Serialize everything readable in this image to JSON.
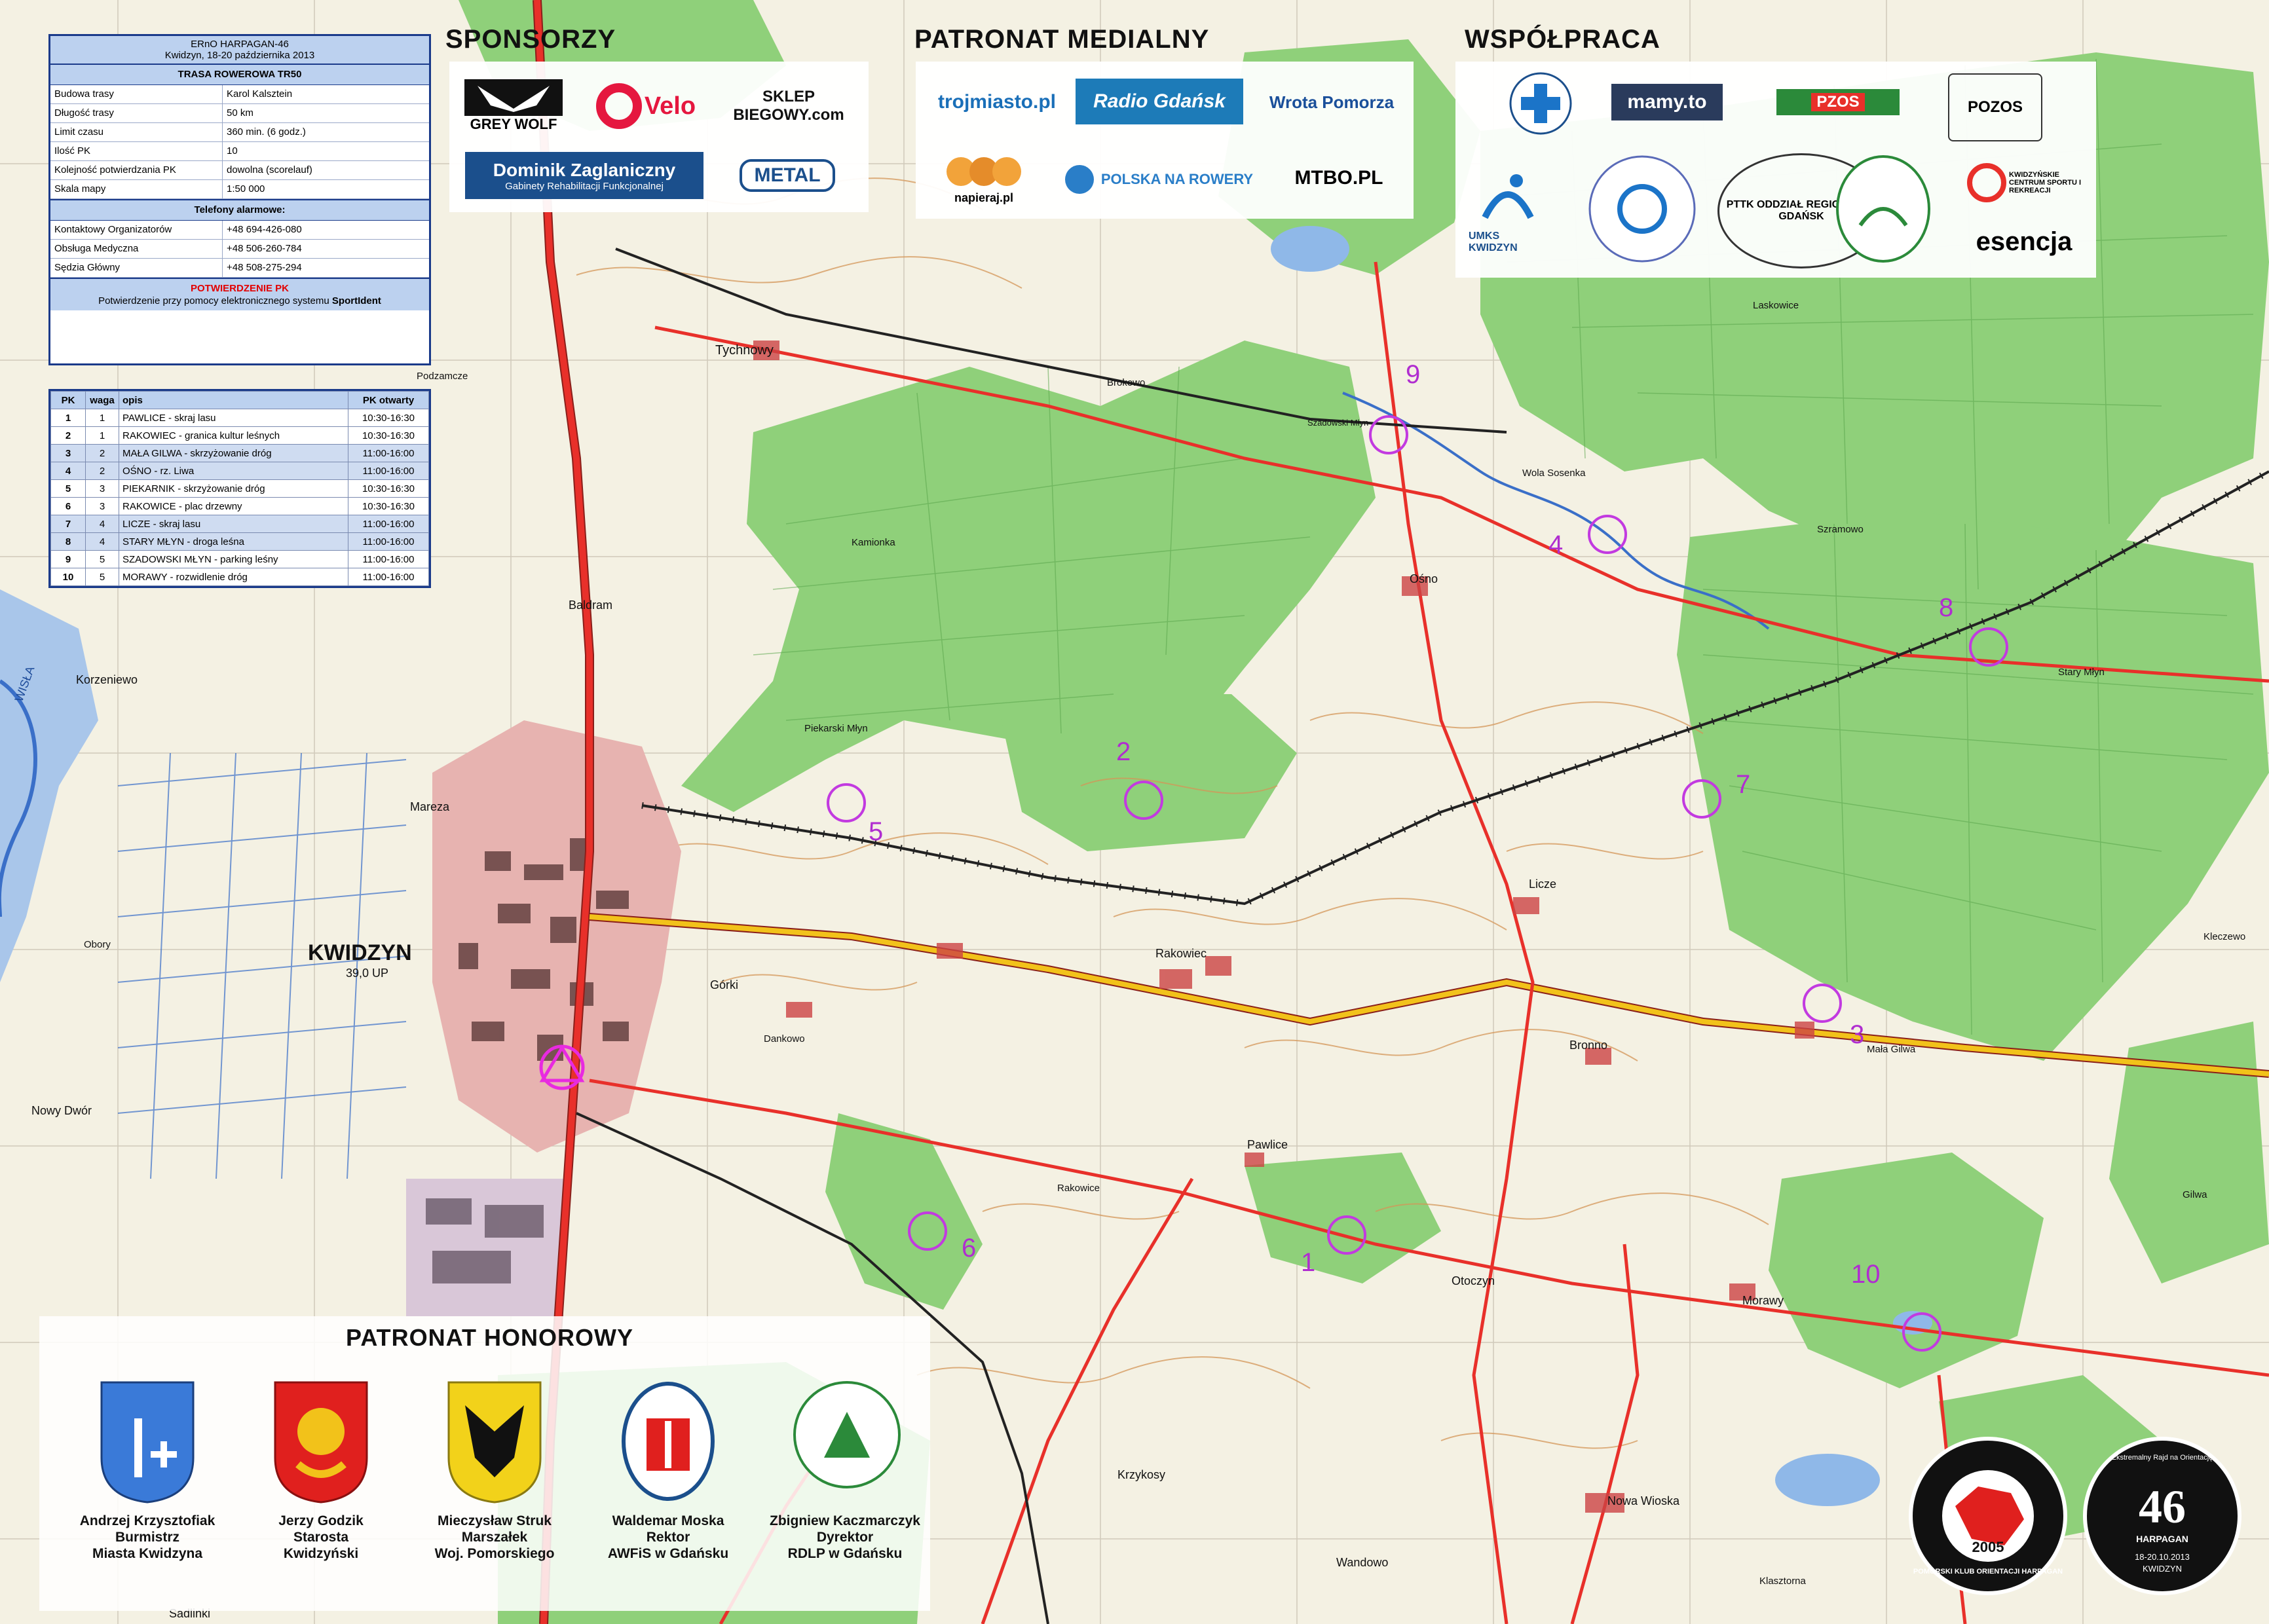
{
  "colors": {
    "forest": "#8fd07a",
    "paper": "#f4f1e3",
    "contour": "#d49558",
    "road": "#e8302a",
    "water": "#3a6fc8",
    "checkpoint": "#c23ae0",
    "panel_border": "#1a3a8a"
  },
  "info": {
    "event": "ERnO HARPAGAN-46",
    "place_date": "Kwidzyn, 18-20 października 2013",
    "route_title": "TRASA ROWEROWA TR50",
    "rows": [
      {
        "label": "Budowa trasy",
        "value": "Karol Kalsztein"
      },
      {
        "label": "Długość trasy",
        "value": "50 km"
      },
      {
        "label": "Limit czasu",
        "value": "360 min. (6 godz.)"
      },
      {
        "label": "Ilość PK",
        "value": "10"
      },
      {
        "label": "Kolejność potwierdzania PK",
        "value": "dowolna (scorelauf)"
      },
      {
        "label": "Skala mapy",
        "value": "1:50 000"
      }
    ],
    "phones_title": "Telefony alarmowe:",
    "phones": [
      {
        "label": "Kontaktowy Organizatorów",
        "value": "+48 694-426-080"
      },
      {
        "label": "Obsługa Medyczna",
        "value": "+48 506-260-784"
      },
      {
        "label": "Sędzia Główny",
        "value": "+48 508-275-294"
      }
    ],
    "confirm_title": "POTWIERDZENIE PK",
    "confirm_text_a": "Potwierdzenie przy pomocy elektronicznego systemu",
    "confirm_text_b": "SportIdent"
  },
  "pk_table": {
    "headers": [
      "PK",
      "waga",
      "opis",
      "PK otwarty"
    ],
    "rows": [
      [
        "1",
        "1",
        "PAWLICE - skraj lasu",
        "10:30-16:30"
      ],
      [
        "2",
        "1",
        "RAKOWIEC - granica kultur leśnych",
        "10:30-16:30"
      ],
      [
        "3",
        "2",
        "MAŁA GILWA - skrzyżowanie dróg",
        "11:00-16:00"
      ],
      [
        "4",
        "2",
        "OŚNO - rz. Liwa",
        "11:00-16:00"
      ],
      [
        "5",
        "3",
        "PIEKARNIK - skrzyżowanie dróg",
        "10:30-16:30"
      ],
      [
        "6",
        "3",
        "RAKOWICE - plac drzewny",
        "10:30-16:30"
      ],
      [
        "7",
        "4",
        "LICZE - skraj lasu",
        "11:00-16:00"
      ],
      [
        "8",
        "4",
        "STARY MŁYN - droga leśna",
        "11:00-16:00"
      ],
      [
        "9",
        "5",
        "SZADOWSKI MŁYN - parking leśny",
        "11:00-16:00"
      ],
      [
        "10",
        "5",
        "MORAWY - rozwidlenie dróg",
        "11:00-16:00"
      ]
    ]
  },
  "sections": {
    "sponsors": "SPONSORZY",
    "media": "PATRONAT MEDIALNY",
    "cooperation": "WSPÓŁPRACA",
    "honorary": "PATRONAT HONOROWY"
  },
  "sponsor_logos": [
    "GREY WOLF",
    "Velo",
    "SKLEP BIEGOWY.com",
    "Dominik Zaglaniczny",
    "Gabinety Rehabilitacji Funkcjonalnej",
    "METAL"
  ],
  "media_logos": [
    "trojmiasto.pl",
    "Radio Gdańsk",
    "Wrota Pomorza",
    "napieraj.pl",
    "POLSKA NA ROWERY",
    "MTBO.PL"
  ],
  "coop_logos": [
    "mamy.to",
    "PZOS",
    "POZOS",
    "UMKS KWIDZYN",
    "PTTK ODDZIAŁ REGIONALNY GDAŃSK",
    "KWIDZYŃSKIE CENTRUM SPORTU I REKREACJI",
    "esencja"
  ],
  "patrons": [
    {
      "line1": "Andrzej Krzysztofiak",
      "line2": "Burmistrz",
      "line3": "Miasta Kwidzyna",
      "crest": "kwidzyn-city-crest"
    },
    {
      "line1": "Jerzy Godzik",
      "line2": "Starosta",
      "line3": "Kwidzyński",
      "crest": "kwidzyn-county-crest"
    },
    {
      "line1": "Mieczysław Struk",
      "line2": "Marszałek",
      "line3": "Woj. Pomorskiego",
      "crest": "pomorskie-crest"
    },
    {
      "line1": "Waldemar Moska",
      "line2": "Rektor",
      "line3": "AWFiS w Gdańsku",
      "crest": "awfis-crest"
    },
    {
      "line1": "Zbigniew Kaczmarczyk",
      "line2": "Dyrektor",
      "line3": "RDLP w Gdańsku",
      "crest": "lasy-panstwowe-logo"
    }
  ],
  "badges": {
    "club": "POMORSKI KLUB ORIENTACJI HARPAGAN",
    "club_year": "2005",
    "event_badge": "HARPAGAN",
    "event_number": "46",
    "event_dates": "18-20.10.2013",
    "event_city": "KWIDZYN",
    "event_prefix": "Ekstremalny Rajd na Orientację"
  },
  "checkpoints": [
    {
      "n": "1",
      "label": "1"
    },
    {
      "n": "2",
      "label": "2"
    },
    {
      "n": "3",
      "label": "3"
    },
    {
      "n": "4",
      "label": "4"
    },
    {
      "n": "5",
      "label": "5"
    },
    {
      "n": "6",
      "label": "6"
    },
    {
      "n": "7",
      "label": "7"
    },
    {
      "n": "8",
      "label": "8"
    },
    {
      "n": "9",
      "label": "9"
    },
    {
      "n": "10",
      "label": "10"
    }
  ],
  "places": {
    "kwidzyn": "KWIDZYN",
    "kwidzyn_pop": "39,0 UP",
    "tychnowy": "Tychnowy",
    "brokowo": "Brokowo",
    "osno": "Ośno",
    "licze": "Licze",
    "rakowiec": "Rakowiec",
    "gorki": "Górki",
    "pawlice": "Pawlice",
    "otoczyn": "Otoczyn",
    "bronno": "Bronno",
    "mala_gilwa": "Mała Gilwa",
    "szramowo": "Szramowo",
    "morawy": "Morawy",
    "nowa_wioska": "Nowa Wioska",
    "krzykosy": "Krzykosy",
    "wandowo": "Wandowo",
    "korzeniewo": "Korzeniewo",
    "mareza": "Mareza",
    "nowy_dwor": "Nowy Dwór",
    "baldram": "Baldram",
    "kamionka": "Kamionka",
    "gilwa": "Gilwa",
    "kleczewo": "Kleczewo",
    "laskowice": "Laskowice",
    "rakowice": "Rakowice",
    "dankowo": "Dankowo",
    "sadlinki": "Sadlinki",
    "klasztorna": "Klasztorna",
    "szadowski_mlyn": "Szadowski Młyn",
    "wola_sosenka": "Wola Sosenka",
    "obory": "Obory",
    "podzamcze": "Podzamcze",
    "wisla": "WISŁA",
    "stary_mlyn": "Stary Młyn",
    "piekarski_mlyn": "Piekarski Młyn"
  }
}
